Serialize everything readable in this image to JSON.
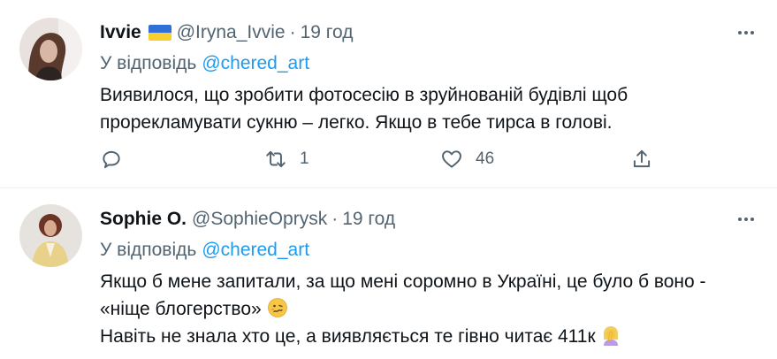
{
  "tweets": [
    {
      "name": "Ivvie",
      "flag_icon": "ukraine-flag-icon",
      "handle": "@Iryna_Ivvie",
      "separator": "·",
      "time": "19 год",
      "reply_prefix": "У відповідь",
      "reply_mention": "@chered_art",
      "text_line1": "Виявилося, що зробити фотосесію в зруйнованій будівлі щоб",
      "text_line2": "прорекламувати сукню – легко. Якщо в тебе тирса в голові.",
      "retweets": "1",
      "likes": "46"
    },
    {
      "name": "Sophie O.",
      "handle": "@SophieOprysk",
      "separator": "·",
      "time": "19 год",
      "reply_prefix": "У відповідь",
      "reply_mention": "@chered_art",
      "text_line1": "Якщо б мене запитали, за що мені соромно в Україні, це було б воно -",
      "text_line2": "«ніще блогерство»",
      "text_line2_emoji": "woozy-face-emoji",
      "text_line3": "Навіть не знала хто це, а виявляється те гівно читає 411к",
      "text_line3_emoji": "woman-facepalming-emoji"
    }
  ],
  "colors": {
    "text": "#0f1419",
    "secondary": "#536471",
    "link": "#1d9bf0",
    "divider": "#eff3f4"
  }
}
